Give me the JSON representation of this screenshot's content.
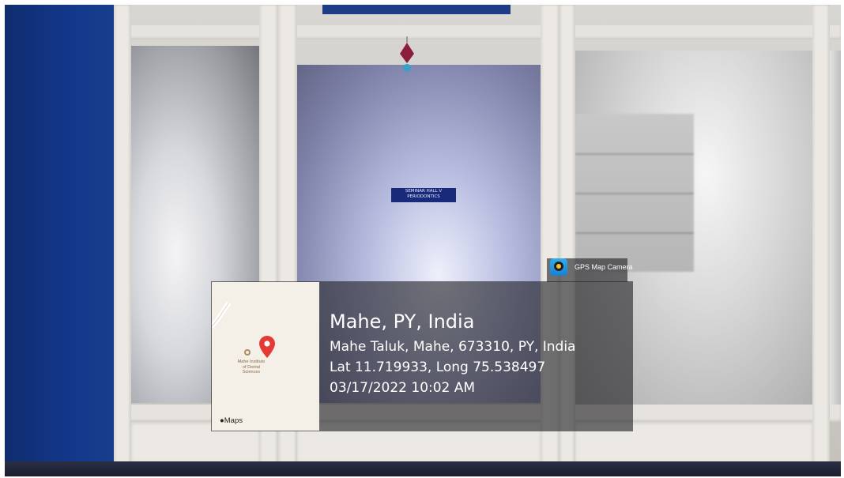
{
  "door_sign": {
    "line1": "SEMINAR HALL V",
    "line2": "PERIODONTICS"
  },
  "map_preview": {
    "place_label_line1": "Mahe Institute",
    "place_label_line2": "of Dental",
    "place_label_line3": "Sciences",
    "brand": "Maps",
    "pin_color": "#e53935"
  },
  "app": {
    "name": "GPS Map Camera"
  },
  "location": {
    "title": "Mahe, PY, India",
    "address": "Mahe Taluk, Mahe, 673310, PY, India",
    "coordinates": "Lat 11.719933, Long 75.538497",
    "datetime": "03/17/2022 10:02 AM"
  }
}
